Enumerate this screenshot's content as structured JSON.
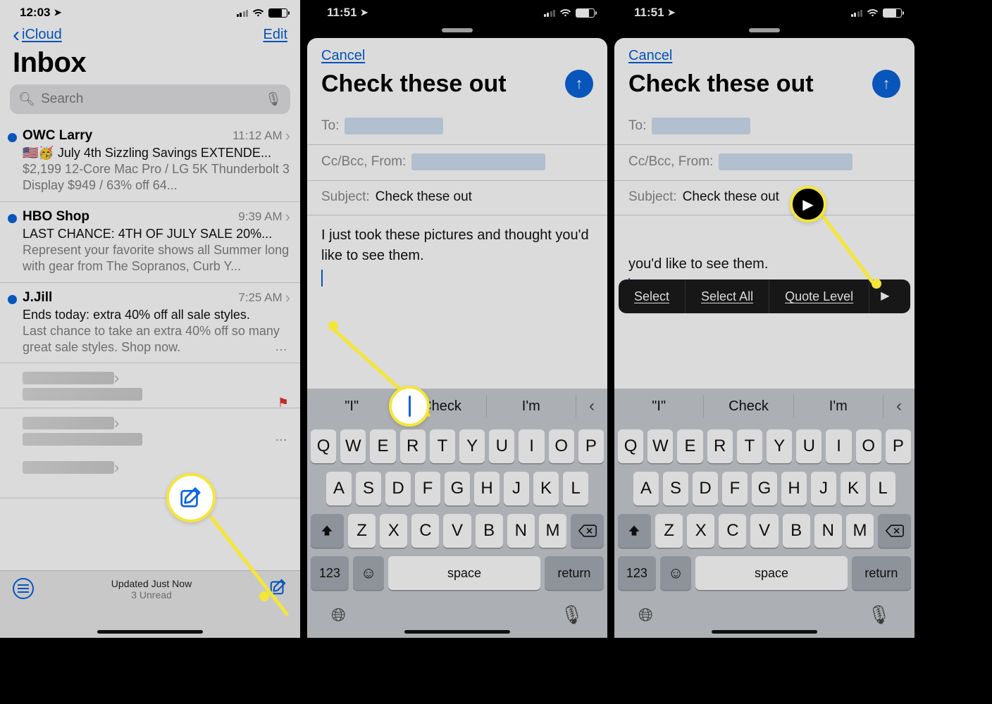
{
  "s1": {
    "status_time": "12:03",
    "back_label": "iCloud",
    "edit_label": "Edit",
    "title": "Inbox",
    "search_placeholder": "Search",
    "messages": [
      {
        "from": "OWC Larry",
        "time": "11:12 AM",
        "subject": "🇺🇸🥳 July 4th Sizzling Savings EXTENDE...",
        "preview": "$2,199 12-Core Mac Pro / LG 5K Thunderbolt 3 Display $949 / 63% off 64..."
      },
      {
        "from": "HBO Shop",
        "time": "9:39 AM",
        "subject": "LAST CHANCE: 4TH OF JULY SALE 20%...",
        "preview": "Represent your favorite shows all Summer long with gear from The Sopranos, Curb Y..."
      },
      {
        "from": "J.Jill",
        "time": "7:25 AM",
        "subject": "Ends today: extra 40% off all sale styles.",
        "preview": "Last chance to take an extra 40% off so many great sale styles. Shop now."
      }
    ],
    "updated": "Updated Just Now",
    "unread": "3 Unread"
  },
  "s2": {
    "status_time": "11:51",
    "cancel": "Cancel",
    "title": "Check these out",
    "to": "To:",
    "cc": "Cc/Bcc, From:",
    "subject_label": "Subject:",
    "subject_value": "Check these out",
    "body": "I just took these pictures and thought you'd like to see them.",
    "sug": [
      "I",
      "Check",
      "I'm"
    ]
  },
  "s3": {
    "status_time": "11:51",
    "cancel": "Cancel",
    "title": "Check these out",
    "to": "To:",
    "cc": "Cc/Bcc, From:",
    "subject_label": "Subject:",
    "subject_value": "Check these out",
    "body_visible": "you'd like to see them.",
    "menu": [
      "Select",
      "Select All",
      "Quote Level"
    ],
    "sug": [
      "I",
      "Check",
      "I'm"
    ]
  },
  "kb": {
    "r1": [
      "Q",
      "W",
      "E",
      "R",
      "T",
      "Y",
      "U",
      "I",
      "O",
      "P"
    ],
    "r2": [
      "A",
      "S",
      "D",
      "F",
      "G",
      "H",
      "J",
      "K",
      "L"
    ],
    "r3": [
      "Z",
      "X",
      "C",
      "V",
      "B",
      "N",
      "M"
    ],
    "num": "123",
    "space": "space",
    "ret": "return"
  }
}
